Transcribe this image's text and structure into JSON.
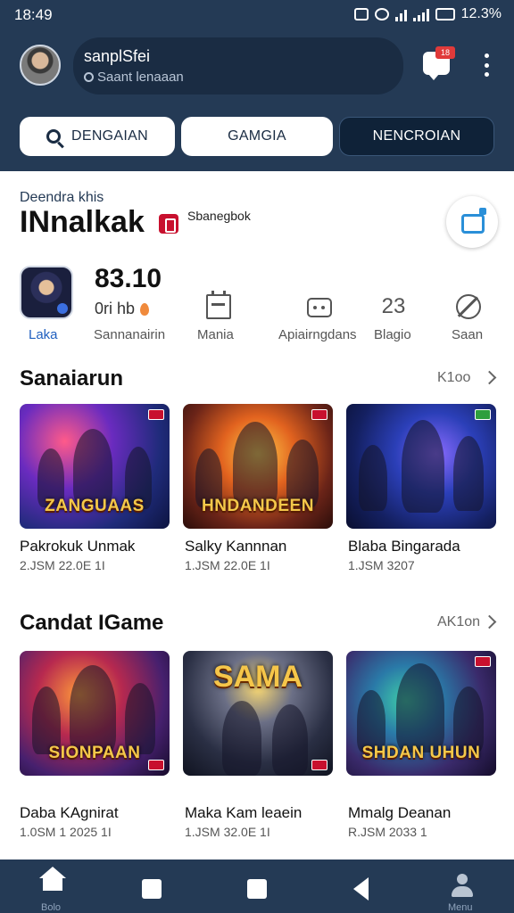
{
  "status_bar": {
    "time": "18:49",
    "battery": "12.3%"
  },
  "profile": {
    "name": "sanplSfei",
    "subtitle": "Saant lenaaan"
  },
  "header": {
    "chat_badge": "18"
  },
  "chips": [
    {
      "label": "DENGAIAN"
    },
    {
      "label": "GAMGIA"
    },
    {
      "label": "NENCROIAN"
    }
  ],
  "hero": {
    "kicker": "Deendra khis",
    "title": "INnalkak",
    "side_label": "Sbanegbok"
  },
  "featured": {
    "stat_value": "83.10",
    "stat_sub": "0ri hb",
    "nav": [
      {
        "label": "Laka"
      },
      {
        "label": "Sannanairin"
      },
      {
        "label": "Mania"
      },
      {
        "label": "Apiairngdans"
      },
      {
        "label": "Blagio"
      },
      {
        "label": "Saan"
      }
    ],
    "num_icon": "23"
  },
  "sections": [
    {
      "title": "Sanaiarun",
      "more": "K1oo",
      "cards": [
        {
          "title": "Pakrokuk Unmak",
          "meta": "2.JSM 22.0E 1I",
          "caption": "ZANGUAAS",
          "accent": "#6a2bbf"
        },
        {
          "title": "Salky Kannnan",
          "meta": "1.JSM 22.0E 1I",
          "caption": "HNDANDEEN",
          "accent": "#e2631f"
        },
        {
          "title": "Blaba Bingarada",
          "meta": "1.JSM 3207",
          "caption": "",
          "accent": "#2b3fb8"
        }
      ]
    },
    {
      "title": "Candat IGame",
      "more": "AK1on",
      "cards": [
        {
          "title": "Daba KAgnirat",
          "meta": "1.0SM 1 2025 1I",
          "caption": "SIONPAAN",
          "accent": "#b7294f"
        },
        {
          "title": "Maka Kam leaein",
          "meta": "1.JSM 32.0E 1I",
          "caption": "SAMA",
          "accent": "#6b6f86"
        },
        {
          "title": "Mmalg Deanan",
          "meta": "R.JSM 2033 1",
          "caption": "SHDAN UHUN",
          "accent": "#2a7aa8"
        }
      ]
    }
  ],
  "bottom_nav": {
    "left_label": "Bolo",
    "right_label": "Menu"
  }
}
